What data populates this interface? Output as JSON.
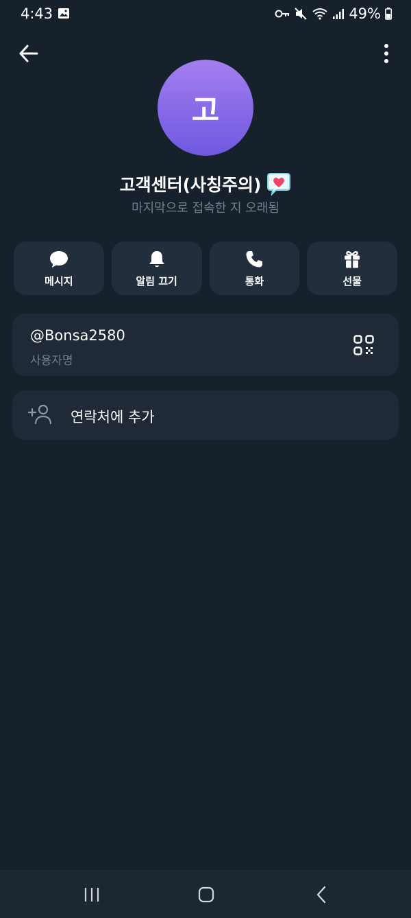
{
  "status_bar": {
    "time": "4:43",
    "battery": "49%"
  },
  "profile": {
    "avatar_letter": "고",
    "name": "고객센터(사칭주의)",
    "last_seen": "마지막으로 접속한 지 오래됨"
  },
  "actions": [
    {
      "label": "메시지",
      "icon": "chat-bubble-icon"
    },
    {
      "label": "알림 끄기",
      "icon": "bell-icon"
    },
    {
      "label": "통화",
      "icon": "phone-icon"
    },
    {
      "label": "선물",
      "icon": "gift-icon"
    }
  ],
  "username_card": {
    "username": "@Bonsa2580",
    "caption": "사용자명"
  },
  "add_contact": {
    "label": "연락처에 추가"
  },
  "colors": {
    "background": "#17212b",
    "card": "#1f2a36",
    "button": "#232e3c",
    "avatar_top": "#a47ff0",
    "avatar_bottom": "#6f58e0",
    "muted_text": "#6d7f90"
  }
}
